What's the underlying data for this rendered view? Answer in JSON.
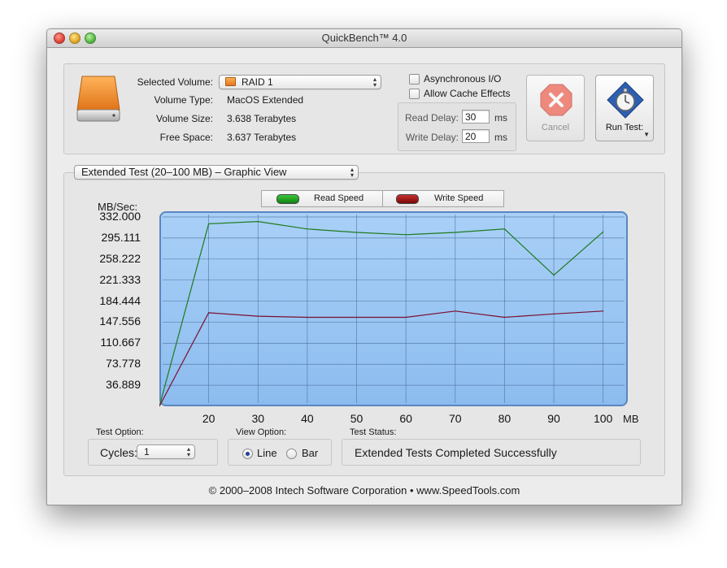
{
  "window": {
    "title": "QuickBench™ 4.0"
  },
  "volume": {
    "selected_label": "Selected Volume:",
    "selected_value": "RAID 1",
    "type_label": "Volume Type:",
    "type_value": "MacOS Extended",
    "size_label": "Volume Size:",
    "size_value": "3.638 Terabytes",
    "free_label": "Free Space:",
    "free_value": "3.637 Terabytes"
  },
  "options": {
    "async_label": "Asynchronous I/O",
    "async_checked": false,
    "cache_label": "Allow Cache Effects",
    "cache_checked": false,
    "read_delay_label": "Read Delay:",
    "read_delay_value": "30",
    "write_delay_label": "Write Delay:",
    "write_delay_value": "20",
    "unit": "ms"
  },
  "buttons": {
    "cancel": "Cancel",
    "run_test": "Run Test:"
  },
  "view_popup": "Extended Test (20–100 MB) – Graphic View",
  "legend": {
    "read": "Read Speed",
    "write": "Write Speed"
  },
  "colors": {
    "read": "#1e7a1e",
    "write": "#7a1030",
    "plot_bg": "#97c4f2",
    "legend_read": "#1a9a1a",
    "legend_write": "#a01010"
  },
  "chart_data": {
    "type": "line",
    "ylabel": "MB/Sec:",
    "xlabel": "MB",
    "y_ticks": [
      "332.000",
      "295.111",
      "258.222",
      "221.333",
      "184.444",
      "147.556",
      "110.667",
      "73.778",
      "36.889"
    ],
    "x_ticks": [
      "20",
      "30",
      "40",
      "50",
      "60",
      "70",
      "80",
      "90",
      "100"
    ],
    "xlim": [
      10,
      105
    ],
    "ylim": [
      0,
      342
    ],
    "x": [
      10,
      20,
      30,
      40,
      50,
      60,
      70,
      80,
      90,
      100
    ],
    "series": [
      {
        "name": "Read Speed",
        "values": [
          0,
          320,
          324,
          311,
          305,
          301,
          305,
          311,
          230,
          306
        ]
      },
      {
        "name": "Write Speed",
        "values": [
          0,
          164,
          158,
          156,
          156,
          156,
          167,
          156,
          162,
          167
        ]
      }
    ],
    "grid": true
  },
  "bottom": {
    "test_option_label": "Test Option:",
    "cycles_label": "Cycles:",
    "cycles_value": "1",
    "view_option_label": "View Option:",
    "line_label": "Line",
    "bar_label": "Bar",
    "view_selected": "Line",
    "test_status_label": "Test Status:",
    "test_status_value": "Extended Tests Completed Successfully"
  },
  "footer": "© 2000–2008 Intech Software Corporation • www.SpeedTools.com"
}
